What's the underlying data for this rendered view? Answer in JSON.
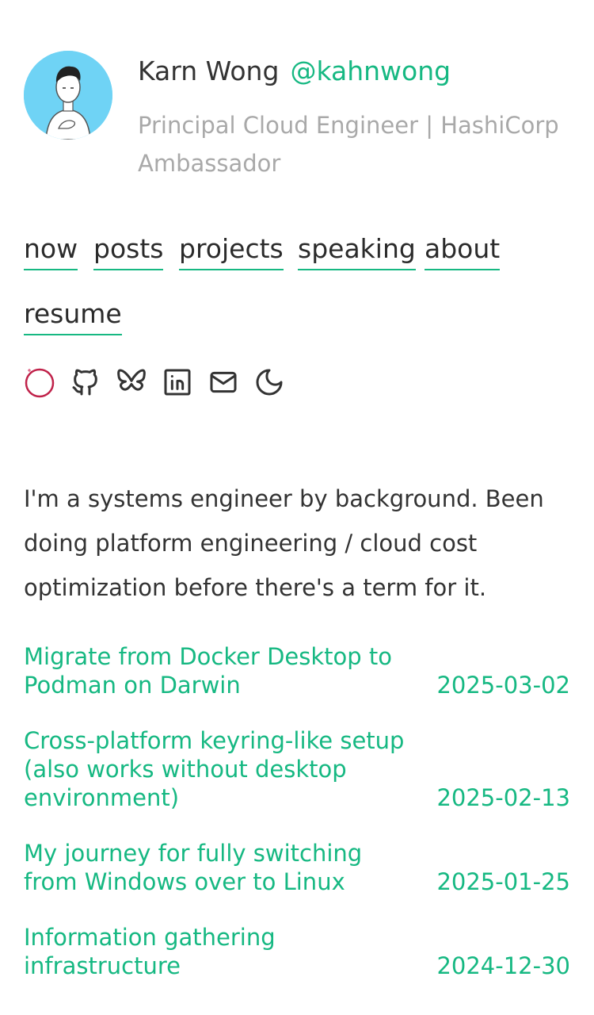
{
  "profile": {
    "name": "Karn Wong",
    "handle": "@kahnwong",
    "subtitle": "Principal Cloud Engineer | HashiCorp Ambassador",
    "avatar_bg": "#6fd3f5"
  },
  "nav": {
    "items": [
      "now",
      "posts",
      "projects",
      "speaking",
      "about",
      "resume"
    ]
  },
  "social_icons": [
    "status-ring-icon",
    "github-icon",
    "bluesky-icon",
    "linkedin-icon",
    "mail-icon",
    "moon-icon"
  ],
  "intro": "I'm a systems engineer by background. Been doing platform engineering / cloud cost optimization before there's a term for it.",
  "posts": [
    {
      "title": "Migrate from Docker Desktop to Podman on Darwin",
      "date": "2025-03-02"
    },
    {
      "title": "Cross-platform keyring-like setup (also works without desktop environment)",
      "date": "2025-02-13"
    },
    {
      "title": "My journey for fully switching from Windows over to Linux",
      "date": "2025-01-25"
    },
    {
      "title": "Information gathering infrastructure",
      "date": "2024-12-30"
    }
  ],
  "colors": {
    "accent": "#16b882",
    "muted": "#a9a9a9",
    "text": "#333333",
    "status_ring": "#c0224a"
  }
}
